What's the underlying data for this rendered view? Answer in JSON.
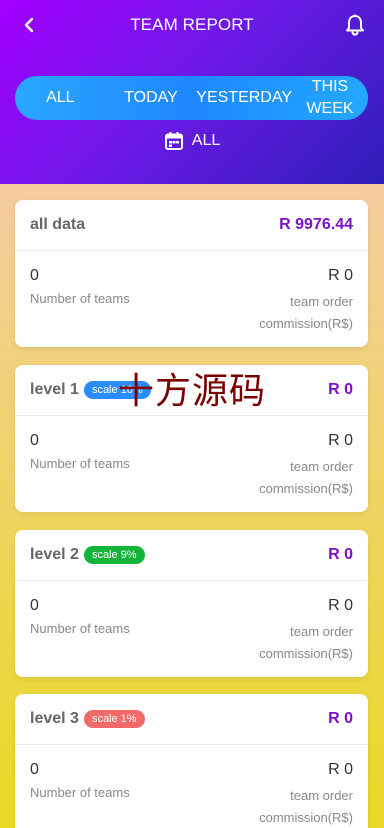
{
  "header": {
    "title": "TEAM REPORT",
    "back_icon": "chevron-left-icon",
    "notify_icon": "bell-icon"
  },
  "tabs": [
    {
      "label": "ALL"
    },
    {
      "label": "TODAY"
    },
    {
      "label": "YESTERDAY"
    },
    {
      "label": "THIS WEEK"
    }
  ],
  "date_filter": {
    "label": "ALL",
    "icon": "calendar-icon"
  },
  "cards": [
    {
      "name": "all data",
      "badge": null,
      "total": "R 9976.44",
      "teams_value": "0",
      "teams_label": "Number of teams",
      "commission_value": "R 0",
      "commission_label": "team order commission(R$)"
    },
    {
      "name": "level 1",
      "badge": "scale 16%",
      "badge_color": "#2b8cff",
      "total": "R 0",
      "teams_value": "0",
      "teams_label": "Number of teams",
      "commission_value": "R 0",
      "commission_label": "team order commission(R$)"
    },
    {
      "name": "level 2",
      "badge": "scale 9%",
      "badge_color": "#12b43a",
      "total": "R 0",
      "teams_value": "0",
      "teams_label": "Number of teams",
      "commission_value": "R 0",
      "commission_label": "team order commission(R$)"
    },
    {
      "name": "level 3",
      "badge": "scale 1%",
      "badge_color": "#f06a6a",
      "total": "R 0",
      "teams_value": "0",
      "teams_label": "Number of teams",
      "commission_value": "R 0",
      "commission_label": "team order commission(R$)"
    }
  ],
  "watermark": "十方源码",
  "colors": {
    "header_gradient": [
      "#a300ff",
      "#2d1fb8"
    ],
    "tab_bar": "#1e88ff",
    "total_text": "#7a12c8"
  }
}
